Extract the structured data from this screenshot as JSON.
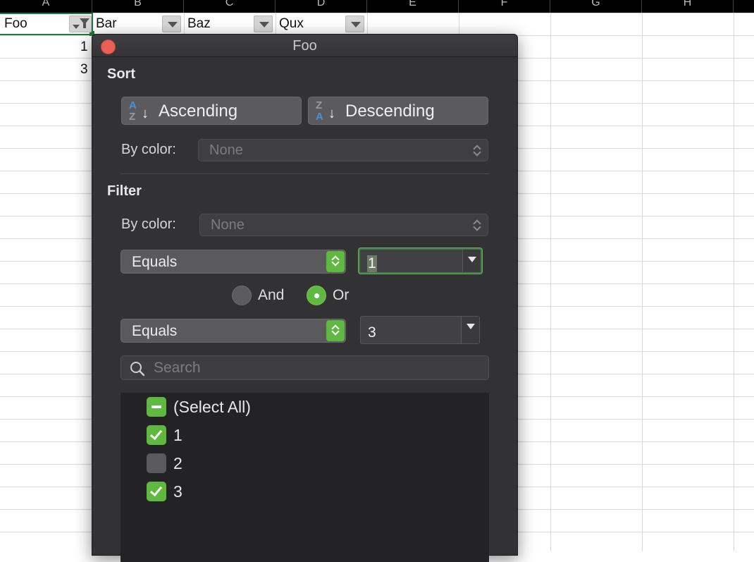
{
  "sheet": {
    "column_headers": [
      "A",
      "B",
      "C",
      "D",
      "E",
      "F",
      "G",
      "H"
    ],
    "header_cells": [
      "Foo",
      "Bar",
      "Baz",
      "Qux"
    ],
    "values": [
      "1",
      "3"
    ]
  },
  "popup": {
    "title": "Foo",
    "sort": {
      "heading": "Sort",
      "ascending_label": "Ascending",
      "descending_label": "Descending",
      "ascending_icon_letters": [
        "A",
        "Z"
      ],
      "descending_icon_letters": [
        "Z",
        "A"
      ],
      "by_color_label": "By color:",
      "by_color_value": "None"
    },
    "filter": {
      "heading": "Filter",
      "by_color_label": "By color:",
      "by_color_value": "None",
      "condition1": {
        "operator": "Equals",
        "value": "1"
      },
      "and_label": "And",
      "or_label": "Or",
      "selected_logic": "Or",
      "condition2": {
        "operator": "Equals",
        "value": "3"
      },
      "search_placeholder": "Search",
      "list": [
        {
          "label": "(Select All)",
          "state": "mixed"
        },
        {
          "label": "1",
          "state": "checked"
        },
        {
          "label": "2",
          "state": "unchecked"
        },
        {
          "label": "3",
          "state": "checked"
        }
      ]
    }
  },
  "colors": {
    "accent_green": "#5fb83f",
    "close_red": "#ec5f57",
    "sort_icon_blue": "#4a90d9",
    "sort_icon_gray": "#9a9a9a",
    "selection_green": "#1f7a3c"
  }
}
